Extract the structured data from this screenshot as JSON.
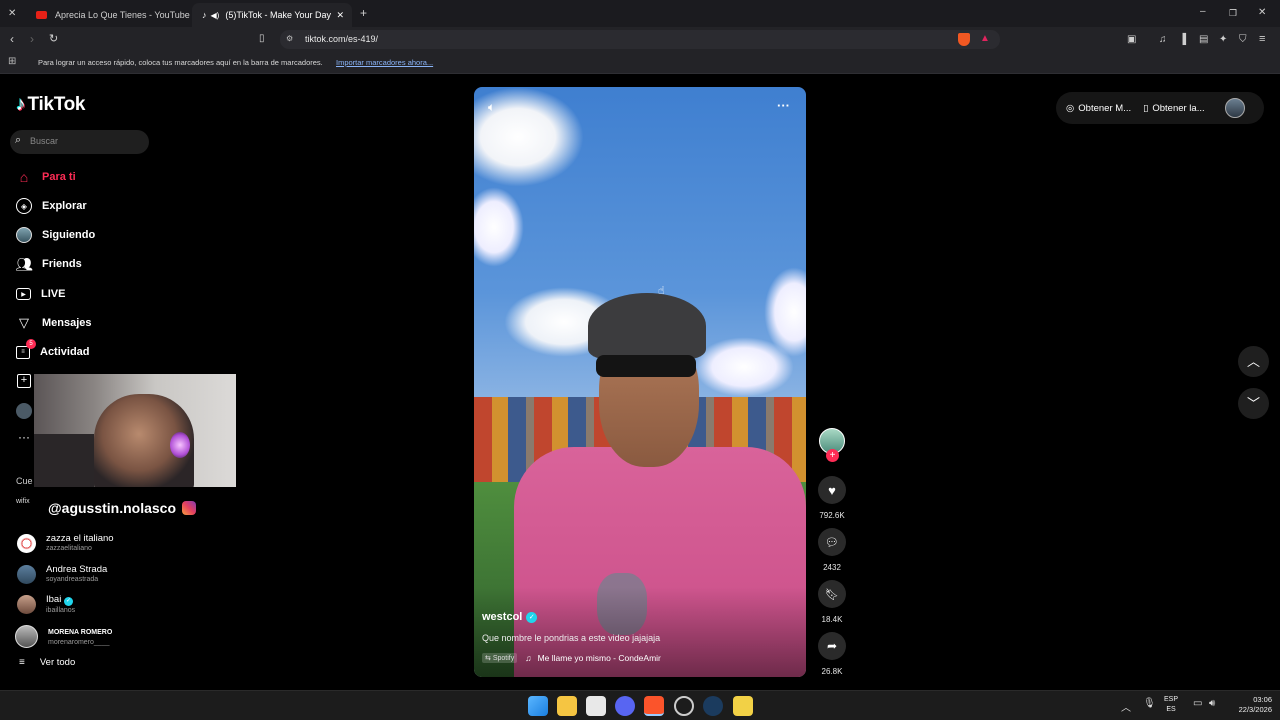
{
  "browser": {
    "tabs": [
      {
        "title": "Aprecia Lo Que Tienes - YouTube",
        "active": false
      },
      {
        "title": "(5)TikTok - Make Your Day",
        "active": true
      }
    ],
    "url": "tiktok.com/es-419/",
    "bookmarks_text": "Para lograr un acceso rápido, coloca tus marcadores aquí en la barra de marcadores.",
    "bookmarks_link": "Importar marcadores ahora..."
  },
  "tiktok": {
    "logo": "TikTok",
    "search_placeholder": "Buscar",
    "nav": [
      {
        "label": "Para ti",
        "icon": "home-icon",
        "active": true
      },
      {
        "label": "Explorar",
        "icon": "compass-icon"
      },
      {
        "label": "Siguiendo",
        "icon": "following-avatar-icon"
      },
      {
        "label": "Friends",
        "icon": "friends-icon"
      },
      {
        "label": "LIVE",
        "icon": "live-icon"
      },
      {
        "label": "Mensajes",
        "icon": "messages-icon"
      },
      {
        "label": "Actividad",
        "icon": "activity-icon",
        "badge": "5"
      }
    ],
    "accounts_header": "Cue",
    "accounts": [
      {
        "name": "zazza el italiano",
        "handle": "zazzaelitaliano"
      },
      {
        "name": "Andrea Strada",
        "handle": "soyandreastrada"
      },
      {
        "name": "Ibai",
        "handle": "ibaillanos",
        "verified": true
      },
      {
        "name": "MORENA ROMERO",
        "handle": "morenaromero____"
      }
    ],
    "see_all": "Ver todo",
    "overlay_handle": "@agusstin.nolasco",
    "video": {
      "author": "westcol",
      "caption": "Que nombre le pondrias a este video jajajaja",
      "music_source": "Spotify",
      "music": "Me llame yo mismo - CondeAmir"
    },
    "actions": {
      "likes": "792.6K",
      "comments": "2432",
      "saves": "18.4K",
      "shares": "26.8K"
    },
    "top_right": {
      "btn1": "Obtener M...",
      "btn2": "Obtener la..."
    }
  },
  "taskbar": {
    "lang": "ESP",
    "lang_sub": "ES",
    "time": "03:06",
    "date": "22/3/2026"
  }
}
